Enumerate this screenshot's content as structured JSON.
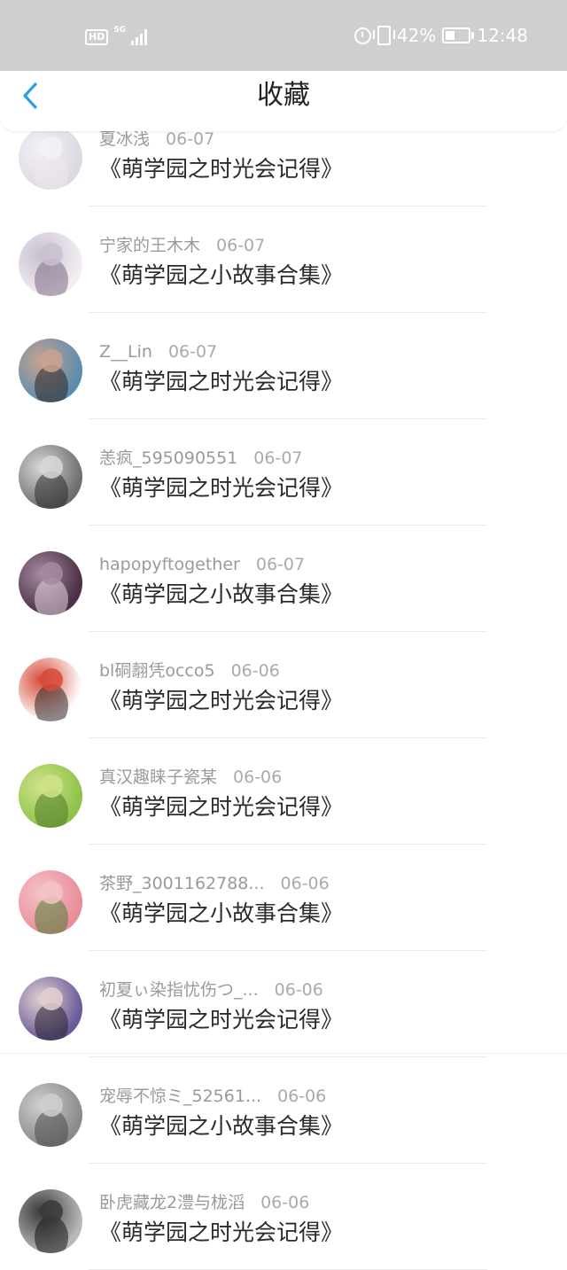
{
  "status_bar": {
    "hd": "HD",
    "network": "5G",
    "battery_level": 42,
    "battery_text": "42%",
    "time": "12:48",
    "icons": [
      "hd-icon",
      "signal-icon",
      "alarm-icon",
      "vibrate-icon",
      "battery-icon"
    ]
  },
  "header": {
    "title": "收藏",
    "back_icon": "chevron-left-icon",
    "accent": "#2a9ee3"
  },
  "items": [
    {
      "author": "夏冰浅",
      "date": "06-07",
      "title": "《萌学园之时光会记得》",
      "avatar_bg": [
        "#dcd9e3",
        "#f3f1f5",
        "#efe7ec"
      ]
    },
    {
      "author": "宁家的王木木",
      "date": "06-07",
      "title": "《萌学园之小故事合集》",
      "avatar_bg": [
        "#f2eef2",
        "#c9bfd0",
        "#7d6a85"
      ]
    },
    {
      "author": "Z__Lin",
      "date": "06-07",
      "title": "《萌学园之时光会记得》",
      "avatar_bg": [
        "#5b8db0",
        "#c9a28f",
        "#2e2420"
      ]
    },
    {
      "author": "恙疯_595090551",
      "date": "06-07",
      "title": "《萌学园之时光会记得》",
      "avatar_bg": [
        "#6e6e6e",
        "#d7d7d7",
        "#2b2b2b"
      ]
    },
    {
      "author": "hapopyftogether",
      "date": "06-07",
      "title": "《萌学园之小故事合集》",
      "avatar_bg": [
        "#4a2f45",
        "#a48aa0",
        "#e6d5df"
      ]
    },
    {
      "author": "bl硐翿凭occo5",
      "date": "06-06",
      "title": "《萌学园之时光会记得》",
      "avatar_bg": [
        "#ffffff",
        "#d64b3a",
        "#2f2624"
      ]
    },
    {
      "author": "真汉趣睐子瓷某",
      "date": "06-06",
      "title": "《萌学园之时光会记得》",
      "avatar_bg": [
        "#8fc24a",
        "#cfe38a",
        "#4f7a2a"
      ]
    },
    {
      "author": "茶野_3001162788...",
      "date": "06-06",
      "title": "《萌学园之小故事合集》",
      "avatar_bg": [
        "#e98d98",
        "#f5c3c7",
        "#4e7f3a"
      ]
    },
    {
      "author": "初夏ぃ染指忧伤つ_...",
      "date": "06-06",
      "title": "《萌学园之时光会记得》",
      "avatar_bg": [
        "#6a5a9a",
        "#e2d0cf",
        "#2a2230"
      ]
    },
    {
      "author": "宠辱不惊ミ_52561...",
      "date": "06-06",
      "title": "《萌学园之小故事合集》",
      "avatar_bg": [
        "#8a8a8a",
        "#cfcfcf",
        "#4a4a4a"
      ]
    },
    {
      "author": "卧虎藏龙2澧与栊滔",
      "date": "06-06",
      "title": "《萌学园之时光会记得》",
      "avatar_bg": [
        "#b8b8b8",
        "#3a3a3a",
        "#171717"
      ]
    }
  ]
}
